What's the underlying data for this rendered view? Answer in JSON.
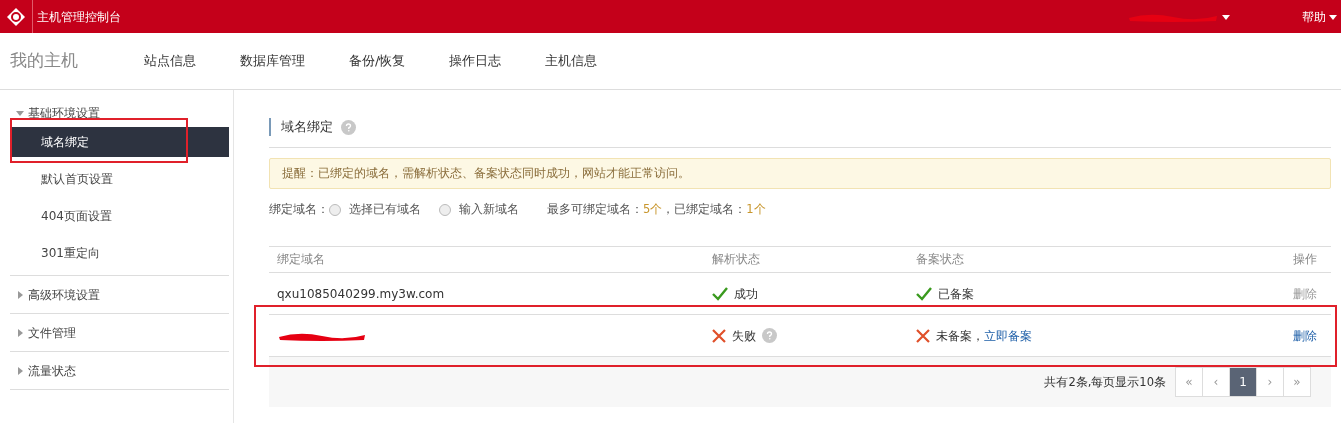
{
  "topbar": {
    "title": "主机管理控制台",
    "account": {
      "kind": "redacted"
    },
    "help": "帮助"
  },
  "nav": {
    "title": "我的主机",
    "items": [
      {
        "label": "站点信息",
        "selected": false
      },
      {
        "label": "数据库管理",
        "selected": false
      },
      {
        "label": "备份/恢复",
        "selected": false
      },
      {
        "label": "操作日志",
        "selected": false
      },
      {
        "label": "主机信息",
        "selected": false
      }
    ]
  },
  "sidebar": {
    "groups": [
      {
        "label": "基础环境设置",
        "expanded": true,
        "children": [
          {
            "label": "域名绑定",
            "selected": true,
            "highlighted": true
          },
          {
            "label": "默认首页设置",
            "selected": false,
            "highlighted": false
          },
          {
            "label": "404页面设置",
            "selected": false,
            "highlighted": false
          },
          {
            "label": "301重定向",
            "selected": false,
            "highlighted": false
          }
        ]
      },
      {
        "label": "高级环境设置",
        "expanded": false
      },
      {
        "label": "文件管理",
        "expanded": false
      },
      {
        "label": "流量状态",
        "expanded": false
      }
    ]
  },
  "section": {
    "title": "域名绑定",
    "notice": "提醒：已绑定的域名，需解析状态、备案状态同时成功，网站才能正常访问。",
    "bind": {
      "label": "绑定域名：",
      "options": [
        {
          "label": "选择已有域名",
          "selected": false
        },
        {
          "label": "输入新域名",
          "selected": false
        }
      ],
      "limit_label": "最多可绑定域名：",
      "limit": "5个",
      "bound_label": "，已绑定域名：",
      "bound": "1个"
    }
  },
  "table": {
    "columns": [
      "绑定域名",
      "解析状态",
      "备案状态",
      "操作"
    ],
    "rows": [
      {
        "domain": {
          "kind": "text",
          "text": "qxu1085040299.my3w.com"
        },
        "resolve": {
          "ok": true,
          "text": "成功",
          "help": false
        },
        "record": {
          "ok": true,
          "text": "已备案"
        },
        "action": {
          "label": "删除",
          "disabled": true
        },
        "highlighted": false
      },
      {
        "domain": {
          "kind": "redacted"
        },
        "resolve": {
          "ok": false,
          "text": "失败",
          "help": true
        },
        "record": {
          "ok": false,
          "text": "未备案，",
          "link": "立即备案"
        },
        "action": {
          "label": "删除",
          "disabled": false
        },
        "highlighted": true
      }
    ]
  },
  "pagination": {
    "summary": "共有2条,每页显示10条",
    "pages": [
      {
        "label": "«",
        "selected": false
      },
      {
        "label": "‹",
        "selected": false
      },
      {
        "label": "1",
        "selected": true
      },
      {
        "label": "›",
        "selected": false
      },
      {
        "label": "»",
        "selected": false
      }
    ]
  }
}
